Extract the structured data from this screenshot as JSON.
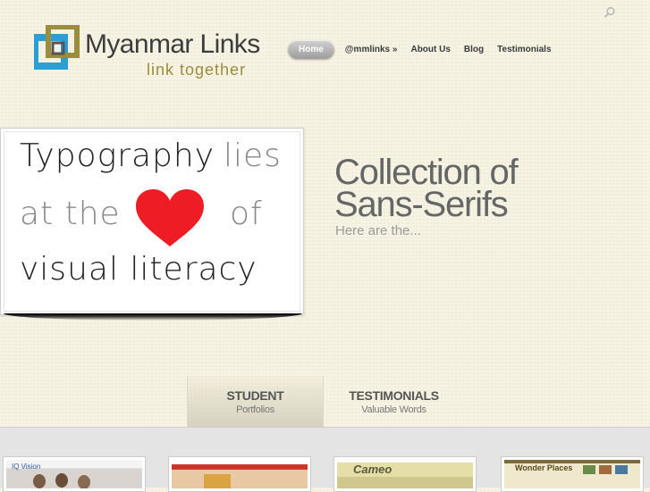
{
  "brand": {
    "name": "Myanmar Links",
    "tagline": "link together",
    "colors": {
      "blue": "#2a9fd6",
      "olive": "#9a8d3b",
      "dark": "#3c3c3c"
    }
  },
  "search": {
    "icon": "search-icon"
  },
  "nav": {
    "items": [
      {
        "label": "Home",
        "active": true
      },
      {
        "label": "@mmlinks »"
      },
      {
        "label": "About Us"
      },
      {
        "label": "Blog"
      },
      {
        "label": "Testimonials"
      }
    ]
  },
  "hero": {
    "slide": {
      "line1": "Typography",
      "line1b": "lies",
      "line2": "at the",
      "line2b": "of",
      "line3": "visual literacy",
      "heart_icon": "heart-icon",
      "heart_color": "#ee1c24"
    },
    "title": "Collection of Sans-Serifs",
    "subtitle": "Here are the..."
  },
  "tabs": [
    {
      "title": "STUDENT",
      "subtitle": "Portfolios",
      "active": true
    },
    {
      "title": "TESTIMONIALS",
      "subtitle": "Valuable Words"
    }
  ],
  "portfolio": {
    "thumbs": [
      {
        "label": "IQ Vision"
      },
      {
        "label": ""
      },
      {
        "label": "Cameo"
      },
      {
        "label": "Wonder Places"
      }
    ]
  }
}
